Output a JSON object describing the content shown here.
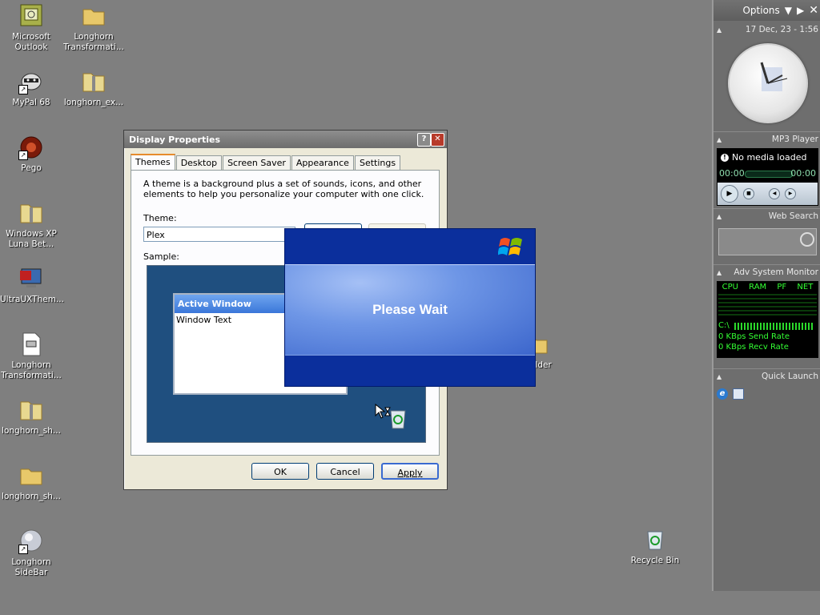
{
  "desktop": {
    "icons": [
      {
        "label": "Microsoft Outlook"
      },
      {
        "label": "Longhorn Transformati..."
      },
      {
        "label": "MyPal 68"
      },
      {
        "label": "longhorn_ex..."
      },
      {
        "label": "Pego"
      },
      {
        "label": "Windows XP Luna Bet..."
      },
      {
        "label": "UltraUXThem..."
      },
      {
        "label": "Longhorn Transformati..."
      },
      {
        "label": "longhorn_sh..."
      },
      {
        "label": "longhorn_sh..."
      },
      {
        "label": "Longhorn SideBar"
      },
      {
        "label": "Recycle Bin"
      },
      {
        "label": "older"
      }
    ]
  },
  "sidebar": {
    "options_label": "Options",
    "clock": {
      "datetime": "17 Dec, 23 - 1:56"
    },
    "mp3": {
      "title": "MP3 Player",
      "status": "No media loaded",
      "time_left": "00:00",
      "time_right": "00:00"
    },
    "web_search": {
      "title": "Web Search"
    },
    "sysmon": {
      "title": "Adv System Monitor",
      "columns": [
        "CPU",
        "RAM",
        "PF",
        "NET"
      ],
      "drive": "C:\\",
      "send_rate": "0 KBps Send Rate",
      "recv_rate": "0 KBps Recv Rate"
    },
    "quick_launch": {
      "title": "Quick Launch"
    }
  },
  "display_properties": {
    "title": "Display Properties",
    "tabs": [
      "Themes",
      "Desktop",
      "Screen Saver",
      "Appearance",
      "Settings"
    ],
    "description": "A theme is a background plus a set of sounds, icons, and other elements to help you personalize your computer with one click.",
    "theme_label": "Theme:",
    "theme_value": "Plex",
    "sample_label": "Sample:",
    "sample_window_title": "Active Window",
    "sample_window_text": "Window Text",
    "buttons": {
      "ok": "OK",
      "cancel": "Cancel",
      "apply": "Apply"
    }
  },
  "splash": {
    "message": "Please Wait"
  },
  "colors": {
    "desktop": "#7f7f7f",
    "xp_blue": "#0b2f9c",
    "accent_orange": "#e68b2c"
  }
}
